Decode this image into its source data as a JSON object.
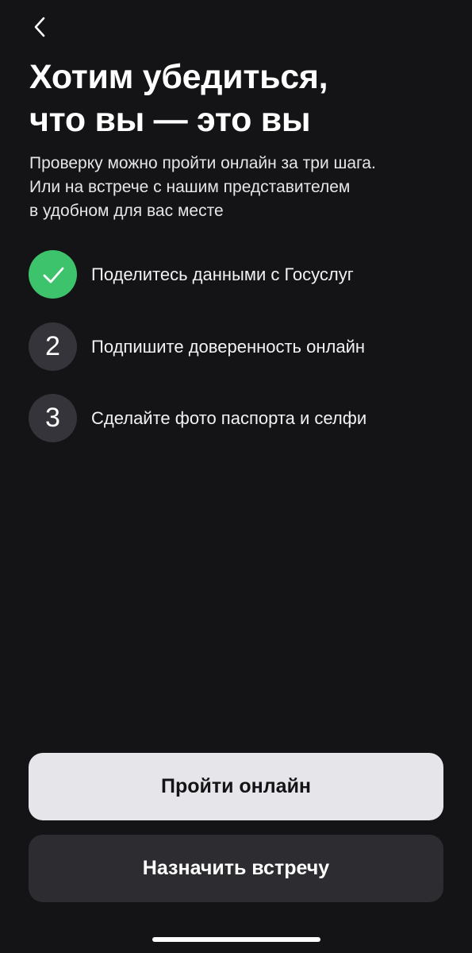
{
  "header": {
    "back_icon": "chevron-left-icon",
    "title_line1": "Хотим убедиться,",
    "title_line2": "что вы — это вы",
    "subtitle_line1": "Проверку можно пройти онлайн за три шага.",
    "subtitle_line2": "Или на встрече с нашим представителем",
    "subtitle_line3": "в удобном для вас месте"
  },
  "steps": [
    {
      "badge": "",
      "icon": "check-icon",
      "status": "done",
      "label": "Поделитесь данными с Госуслуг"
    },
    {
      "badge": "2",
      "status": "pending",
      "label": "Подпишите доверенность онлайн"
    },
    {
      "badge": "3",
      "status": "pending",
      "label": "Сделайте фото паспорта и селфи"
    }
  ],
  "actions": {
    "primary_label": "Пройти онлайн",
    "secondary_label": "Назначить встречу"
  },
  "colors": {
    "background": "#141416",
    "done_badge": "#3dc36b",
    "pending_badge": "#34343a",
    "primary_button": "#e6e6ea",
    "secondary_button": "#2d2d31"
  }
}
